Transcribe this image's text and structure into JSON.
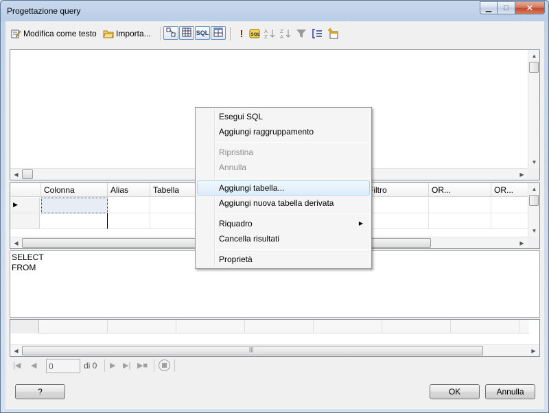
{
  "window": {
    "title": "Progettazione query",
    "close_glyph": "✕",
    "min_glyph": "▁",
    "max_glyph": "□"
  },
  "toolbar": {
    "edit_as_text": "Modifica come testo",
    "import": "Importa...",
    "sql_label": "SQL",
    "icons": [
      "edit-text-icon",
      "import-folder-icon",
      "diagram-pane-icon",
      "grid-pane-icon",
      "sql-pane-icon",
      "results-pane-icon",
      "run-icon",
      "verify-sql-icon",
      "sort-asc-icon",
      "sort-desc-icon",
      "filter-icon",
      "group-by-icon",
      "add-table-icon"
    ]
  },
  "grid": {
    "columns": [
      "Colonna",
      "Alias",
      "Tabella",
      "Filtro",
      "OR...",
      "OR..."
    ]
  },
  "sql": {
    "lines": [
      "SELECT",
      "FROM"
    ]
  },
  "nav": {
    "record_value": "0",
    "of_label": "di 0"
  },
  "buttons": {
    "help": "?",
    "ok": "OK",
    "cancel": "Annulla"
  },
  "context_menu": {
    "items": [
      {
        "label": "Esegui SQL",
        "enabled": true
      },
      {
        "label": "Aggiungi raggruppamento",
        "enabled": true
      },
      {
        "label": "Ripristina",
        "enabled": false
      },
      {
        "label": "Annulla",
        "enabled": false
      },
      {
        "label": "Aggiungi tabella...",
        "enabled": true,
        "hover": true
      },
      {
        "label": "Aggiungi nuova tabella derivata",
        "enabled": true
      },
      {
        "label": "Riquadro",
        "enabled": true,
        "submenu": true
      },
      {
        "label": "Cancella risultati",
        "enabled": true
      },
      {
        "label": "Proprietà",
        "enabled": true
      }
    ]
  },
  "colors": {
    "accent": "#3399ff",
    "hover_border": "#a8d8eb",
    "disabled_text": "#8d8d8d"
  }
}
